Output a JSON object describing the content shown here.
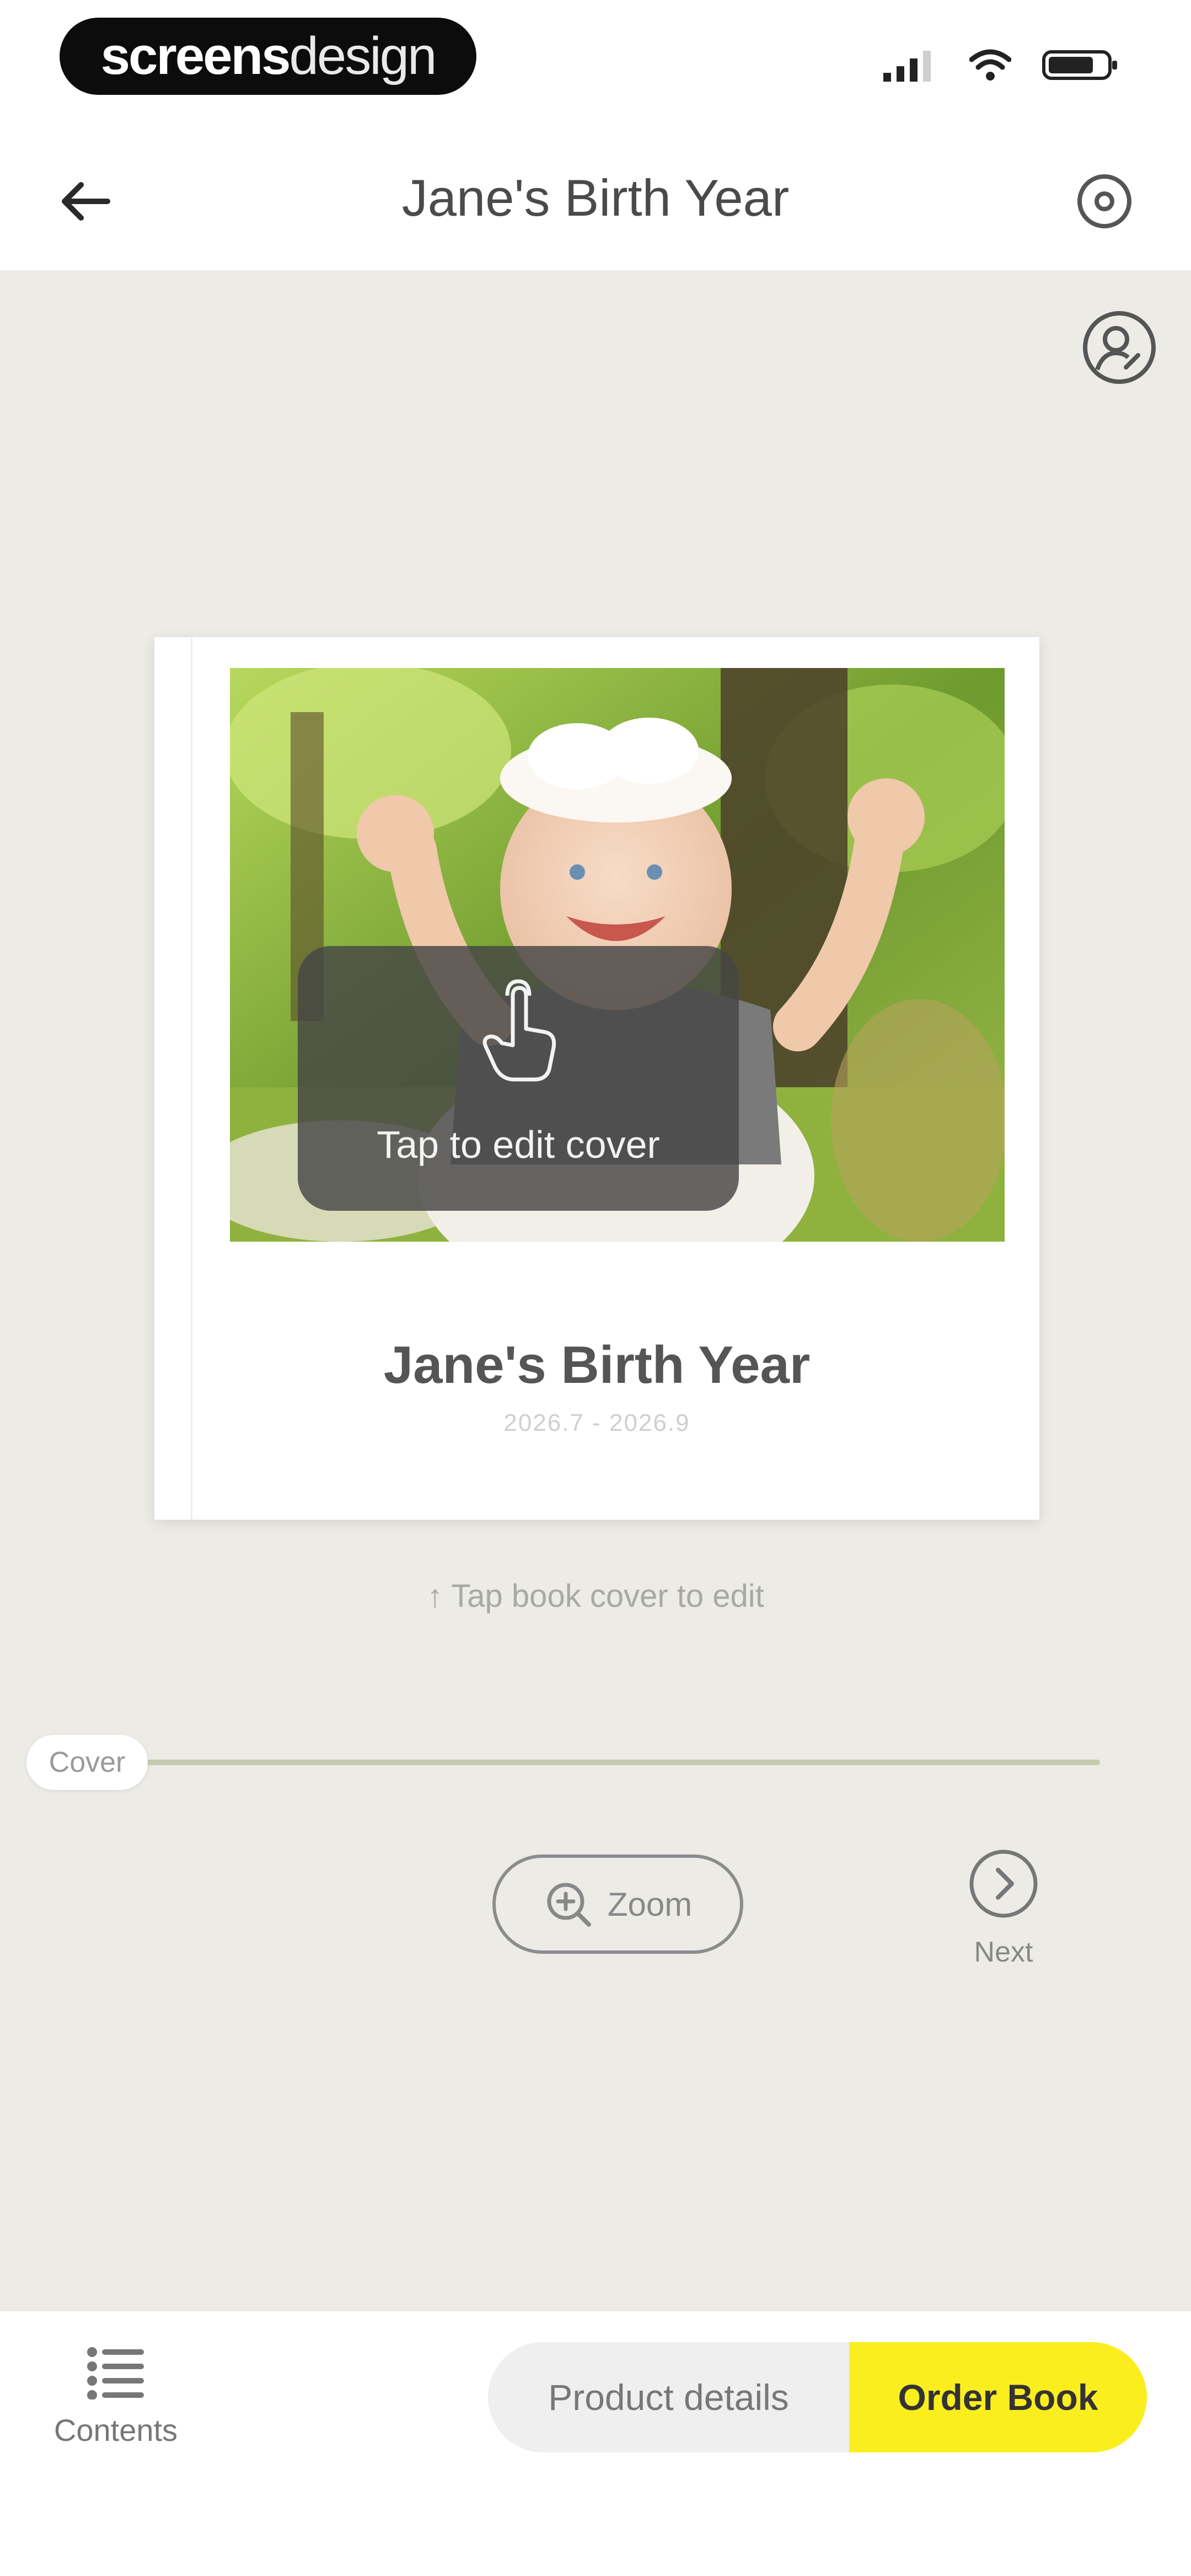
{
  "status_bar": {
    "brand_bold": "screens",
    "brand_light": "design"
  },
  "header": {
    "title": "Jane's Birth Year"
  },
  "book": {
    "cover_title": "Jane's Birth Year",
    "cover_dates": "2026.7 - 2026.9",
    "edit_overlay_text": "Tap to edit cover",
    "hint": "↑ Tap book cover to edit"
  },
  "pager": {
    "current_chip": "Cover",
    "zoom_label": "Zoom",
    "next_label": "Next"
  },
  "bottom_bar": {
    "contents_label": "Contents",
    "product_details_label": "Product details",
    "order_book_label": "Order Book"
  },
  "colors": {
    "accent_yellow": "#fbee1f",
    "canvas_bg": "#ecebe6",
    "track": "#c6cbb0"
  },
  "icons": {
    "back": "arrow-left-icon",
    "settings": "ring-icon",
    "share": "user-edit-icon",
    "tap": "tap-hand-icon",
    "zoom": "zoom-in-icon",
    "next": "chevron-right-circle-icon",
    "contents": "list-icon"
  }
}
